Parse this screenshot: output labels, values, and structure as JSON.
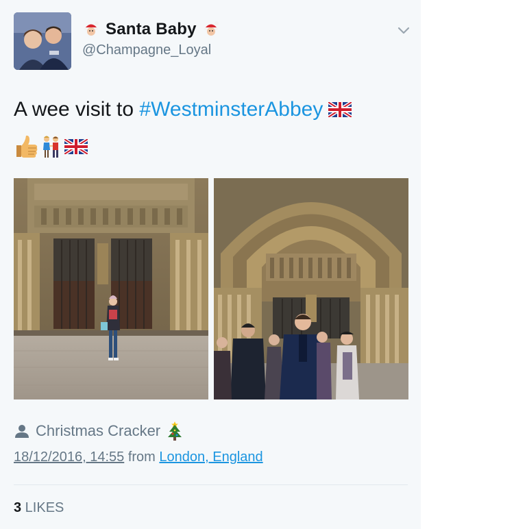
{
  "author": {
    "display_name": "Santa Baby",
    "handle": "@Champagne_Loyal",
    "name_emoji": "santa-face-icon"
  },
  "tweet": {
    "text_prefix": "A wee visit to ",
    "hashtag": "#WestminsterAbbey",
    "emoji_line": [
      "thumbs-up-icon",
      "couple-holding-hands-icon",
      "union-jack-flag-icon"
    ]
  },
  "photos": [
    {
      "alt_icon": "westminster-abbey-photo-woman"
    },
    {
      "alt_icon": "westminster-abbey-photo-man"
    }
  ],
  "tagged": {
    "name": "Christmas Cracker",
    "icon": "person-icon",
    "emoji": "christmas-tree-icon"
  },
  "meta": {
    "timestamp": "18/12/2016, 14:55",
    "from_label": " from ",
    "location": "London, England"
  },
  "likes": {
    "count": "3",
    "label": " LIKES"
  },
  "colors": {
    "link": "#1b95e0",
    "secondary": "#657786",
    "card_bg": "#f5f8fa"
  }
}
